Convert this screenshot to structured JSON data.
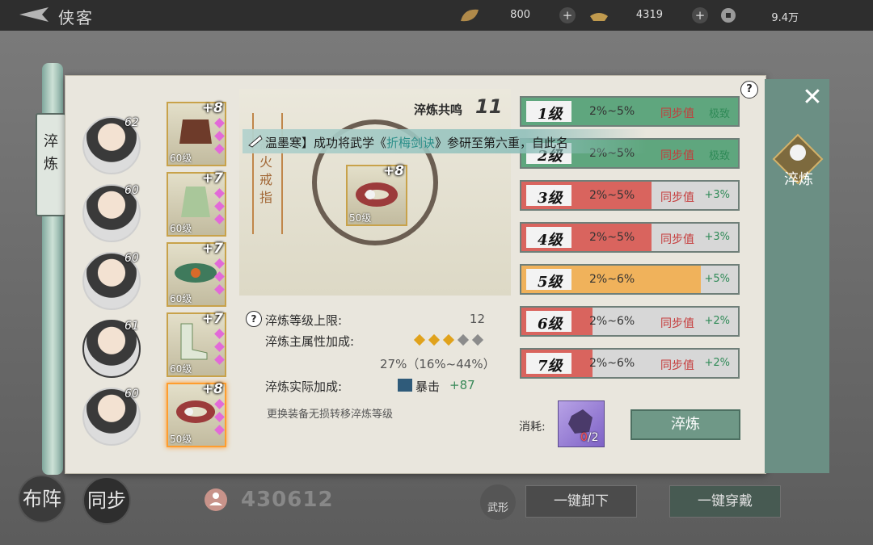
{
  "topbar": {
    "title": "侠客",
    "resources": [
      {
        "icon": "leaf-icon",
        "value": "800"
      },
      {
        "icon": "ingot-icon",
        "value": "4319"
      },
      {
        "icon": "coin-icon",
        "value": "9.4万"
      }
    ]
  },
  "scroll_tab": "淬炼",
  "side_tab": {
    "label": "淬炼"
  },
  "characters": [
    {
      "level": "62"
    },
    {
      "level": "60"
    },
    {
      "level": "60"
    },
    {
      "level": "61"
    },
    {
      "level": "60"
    }
  ],
  "equipment": [
    {
      "plus": "+8",
      "level": "60级",
      "type": "armor"
    },
    {
      "plus": "+7",
      "level": "60级",
      "type": "robe"
    },
    {
      "plus": "+7",
      "level": "60级",
      "type": "belt"
    },
    {
      "plus": "+7",
      "level": "60级",
      "type": "boots"
    },
    {
      "plus": "+8",
      "level": "50级",
      "type": "ring",
      "selected": true
    }
  ],
  "center": {
    "resonance_label": "淬炼共鸣",
    "resonance_value": "11",
    "item_name": "高火戒指",
    "item_plus": "+8",
    "item_level": "50级"
  },
  "broadcast": {
    "prefix": "温墨寒】成功将武学《",
    "highlight": "折梅剑诀",
    "suffix": "》参研至第六重，自此名"
  },
  "stats": {
    "cap_label": "淬炼等级上限:",
    "cap_value": "12",
    "main_label": "淬炼主属性加成:",
    "main_stars_filled": 3,
    "main_stars_total": 5,
    "main_percent": "27%（16%~44%）",
    "actual_label": "淬炼实际加成:",
    "actual_stat": "暴击",
    "actual_value": "+87",
    "note": "更换装备无损转移淬炼等级"
  },
  "levels": [
    {
      "label": "1级",
      "range": "2%~5%",
      "sync": "同步值",
      "bonus": "极致",
      "fill": 1.0,
      "color": "#5fa67e"
    },
    {
      "label": "2级",
      "range": "2%~5%",
      "sync": "同步值",
      "bonus": "极致",
      "fill": 1.0,
      "color": "#5fa67e"
    },
    {
      "label": "3级",
      "range": "2%~5%",
      "sync": "同步值",
      "bonus": "+3%",
      "fill": 0.6,
      "color": "#d9645e"
    },
    {
      "label": "4级",
      "range": "2%~5%",
      "sync": "同步值",
      "bonus": "+3%",
      "fill": 0.6,
      "color": "#d9645e"
    },
    {
      "label": "5级",
      "range": "2%~6%",
      "sync": "",
      "bonus": "+5%",
      "fill": 0.83,
      "color": "#f0b25b"
    },
    {
      "label": "6级",
      "range": "2%~6%",
      "sync": "同步值",
      "bonus": "+2%",
      "fill": 0.33,
      "color": "#d9645e"
    },
    {
      "label": "7级",
      "range": "2%~6%",
      "sync": "同步值",
      "bonus": "+2%",
      "fill": 0.33,
      "color": "#d9645e"
    }
  ],
  "consume": {
    "label": "消耗:",
    "have": "0",
    "need": "2",
    "sep": "/"
  },
  "actions": {
    "refine": "淬炼",
    "unequip_all": "一键卸下",
    "equip_all": "一键穿戴",
    "formation": "布阵",
    "sync": "同步",
    "martial": "武形"
  },
  "power": "430612",
  "help": "?"
}
